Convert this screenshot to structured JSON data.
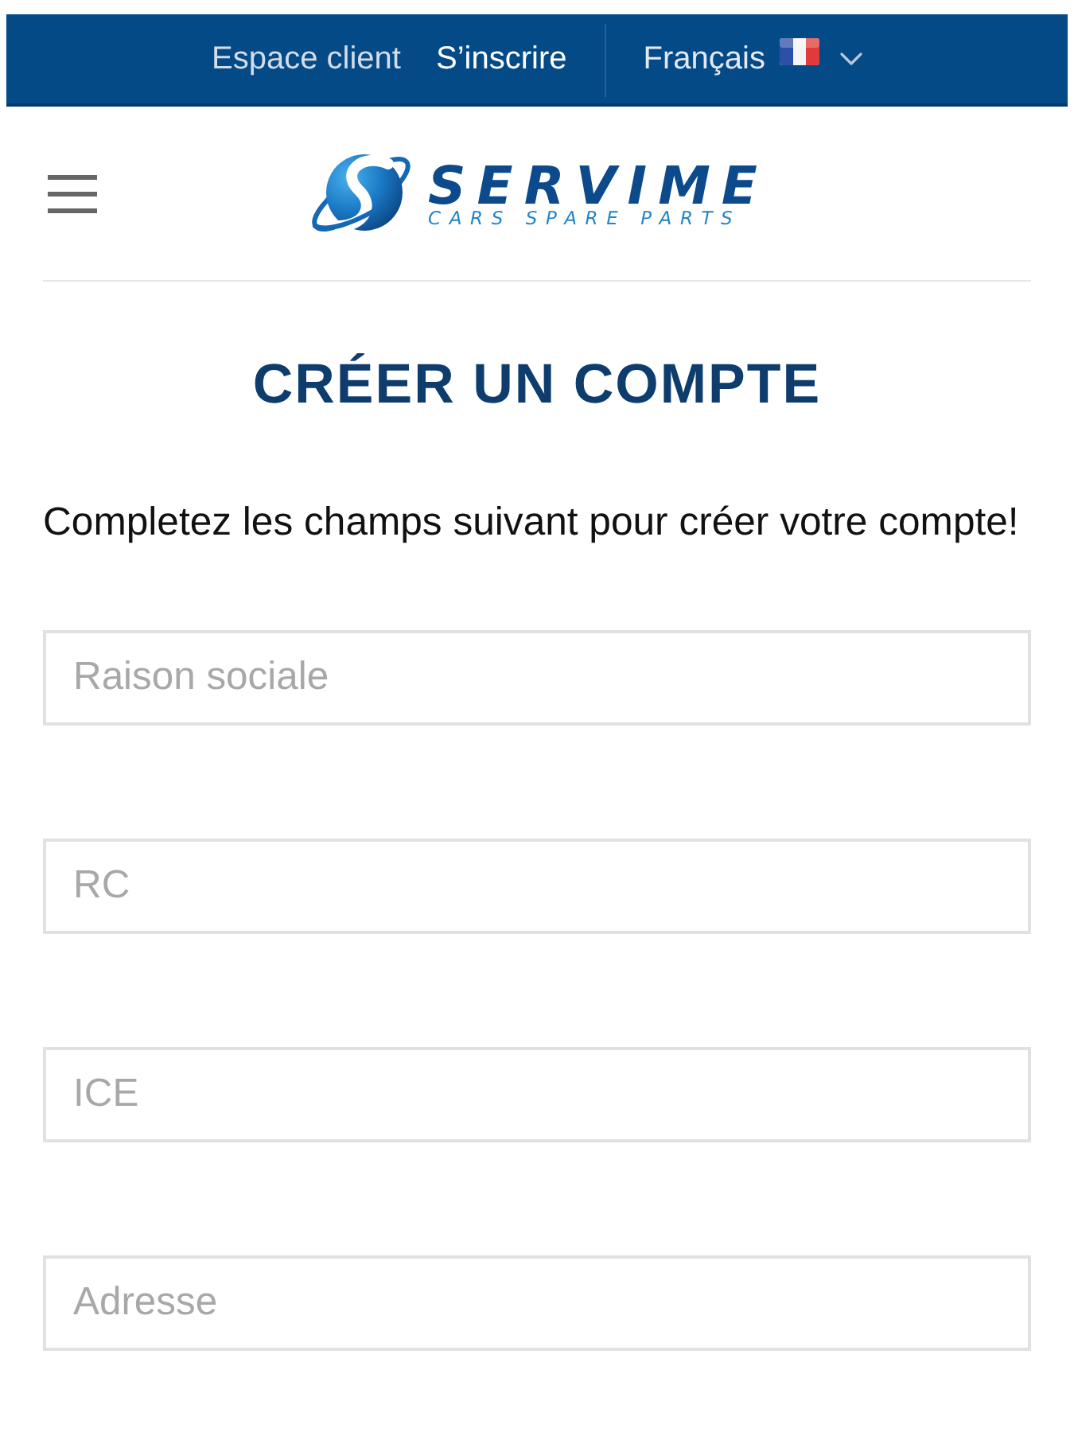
{
  "top_bar": {
    "links": [
      {
        "label": "Espace client",
        "selected": false
      },
      {
        "label": "S’inscrire",
        "selected": true
      }
    ],
    "language": {
      "label": "Français"
    }
  },
  "header": {
    "logo": {
      "name": "SERVIME",
      "tagline": "CARS SPARE PARTS"
    }
  },
  "page": {
    "title": "CRÉER UN COMPTE",
    "intro": "Completez les champs suivant pour créer votre compte!"
  },
  "form": {
    "fields": [
      {
        "placeholder": "Raison sociale"
      },
      {
        "placeholder": "RC"
      },
      {
        "placeholder": "ICE"
      },
      {
        "placeholder": "Adresse"
      }
    ]
  }
}
